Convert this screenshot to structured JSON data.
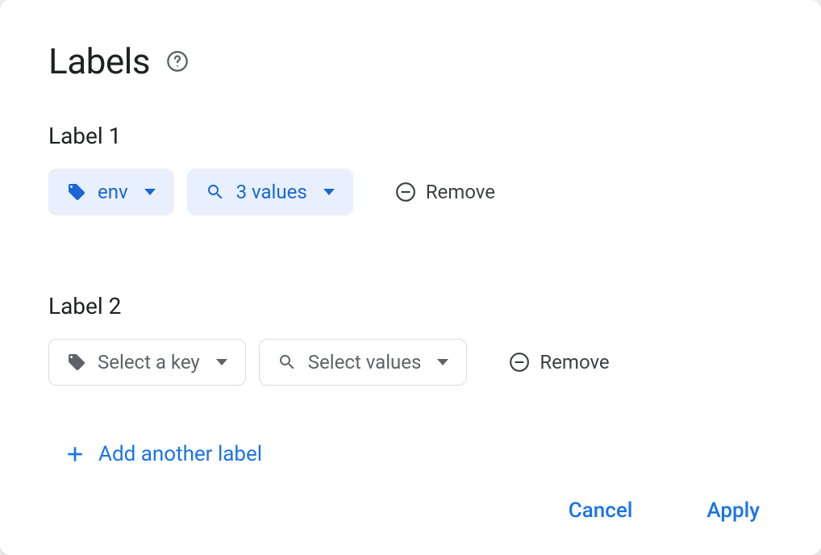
{
  "dialog": {
    "title": "Labels"
  },
  "labels": [
    {
      "heading": "Label 1",
      "key": "env",
      "key_placeholder": "Select a key",
      "values_text": "3 values",
      "values_placeholder": "Select values",
      "has_key": true,
      "remove_label": "Remove"
    },
    {
      "heading": "Label 2",
      "key": "",
      "key_placeholder": "Select a key",
      "values_text": "",
      "values_placeholder": "Select values",
      "has_key": false,
      "remove_label": "Remove"
    }
  ],
  "add_label": "Add another label",
  "actions": {
    "cancel": "Cancel",
    "apply": "Apply"
  }
}
